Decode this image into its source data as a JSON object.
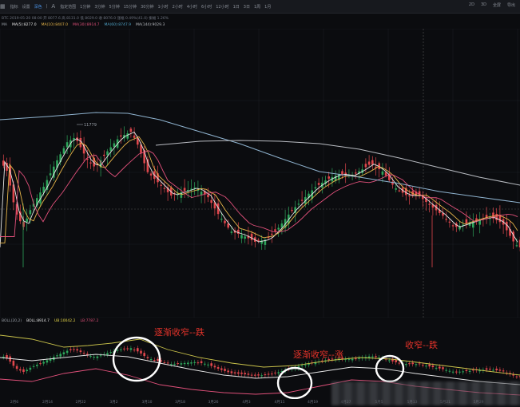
{
  "toolbar": {
    "items": [
      {
        "label": "指标",
        "active": false
      },
      {
        "label": "设置",
        "active": false
      },
      {
        "label": "深色",
        "active": true
      },
      {
        "label": "",
        "icon": "sep",
        "active": false
      },
      {
        "label": "指定范围",
        "active": false
      },
      {
        "label": "1分钟",
        "active": false
      },
      {
        "label": "3分钟",
        "active": false
      },
      {
        "label": "5分钟",
        "active": false
      },
      {
        "label": "15分钟",
        "active": false
      },
      {
        "label": "30分钟",
        "active": false
      },
      {
        "label": "1小时",
        "active": false
      },
      {
        "label": "2小时",
        "active": false
      },
      {
        "label": "4小时",
        "active": false
      },
      {
        "label": "6小时",
        "active": false
      },
      {
        "label": "12小时",
        "active": false
      },
      {
        "label": "1日",
        "active": false
      },
      {
        "label": "3日",
        "active": false
      },
      {
        "label": "1周",
        "active": false
      },
      {
        "label": "1月",
        "active": false
      }
    ],
    "right_items": [
      "2D",
      "3D",
      "全屏",
      "导出"
    ]
  },
  "info_line": "BTC 2019-05-20 08:00  开 8077.6  高 8131.0  低 8029.0  收 8076.0  涨幅 0.49%(41.0)  振幅 1.26%",
  "ma_legend": {
    "name": "MA",
    "items": [
      {
        "label": "MA(5):8277.0",
        "color": "#e6e6e6"
      },
      {
        "label": "MA(10):8407.0",
        "color": "#e8b64a"
      },
      {
        "label": "MA(30):8914.7",
        "color": "#e0507a"
      },
      {
        "label": "MA(60):8747.9",
        "color": "#4fa3c7"
      },
      {
        "label": "MA(144):9029.3",
        "color": "#b9bcc2"
      }
    ]
  },
  "high_label": "11779",
  "boll_legend": {
    "items": [
      {
        "label": "BOLL(20,2)",
        "color": "#9aa0a8"
      },
      {
        "label": "BOLL:8914.7",
        "color": "#e6e6e6"
      },
      {
        "label": "UB:10042.2",
        "color": "#e8d94a"
      },
      {
        "label": "LB:7787.2",
        "color": "#e0507a"
      }
    ]
  },
  "annotations": {
    "a1": "逐渐收窄--跌",
    "a2": "逐渐收窄--涨",
    "a3": "收窄--跌"
  },
  "xaxis": [
    "2月6",
    "2月14",
    "2月22",
    "3月2",
    "3月10",
    "3月18",
    "3月26",
    "4月3",
    "4月11",
    "4月19",
    "4月27",
    "5月5",
    "5月13",
    "5月21",
    "5月29"
  ],
  "colors": {
    "up": "#2ea55b",
    "down": "#e0474c",
    "bg": "#0b0c0f",
    "ma5": "#e6e6e6",
    "ma10": "#e8b64a",
    "ma30": "#e0507a",
    "ma144": "#b9bcc2",
    "boll_ub": "#c9c24a",
    "circle": "#ffffff"
  }
}
